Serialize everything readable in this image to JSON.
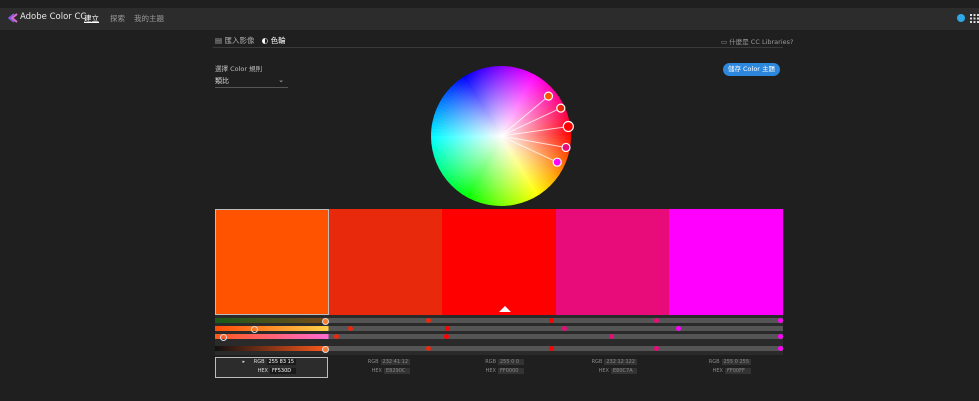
{
  "topbar": {
    "brand": "Adobe Color CC",
    "nav": [
      "建立",
      "探索",
      "我的主題"
    ]
  },
  "header": {
    "tab_import": "匯入影像",
    "tab_wheel": "色輪",
    "libraries_hint": "什麼是 CC Libraries?"
  },
  "rule": {
    "label": "選擇 Color 規則",
    "selected": "類比"
  },
  "save_button": "儲存 Color 主題",
  "swatches": [
    {
      "hex": "#FF5300",
      "rgb": "255 83 15",
      "hex_text": "FF530D",
      "selected": true
    },
    {
      "hex": "#E8290C",
      "rgb": "232 41 12",
      "hex_text": "E8290C",
      "selected": false
    },
    {
      "hex": "#FF0000",
      "rgb": "255 0 0",
      "hex_text": "FF0000",
      "selected": false
    },
    {
      "hex": "#E80C7A",
      "rgb": "232 12 122",
      "hex_text": "E80C7A",
      "selected": false
    },
    {
      "hex": "#FF00FF",
      "rgb": "255 0 255",
      "hex_text": "FF00FF",
      "selected": false
    }
  ],
  "labels": {
    "rgb": "RGB",
    "hex": "HEX"
  }
}
